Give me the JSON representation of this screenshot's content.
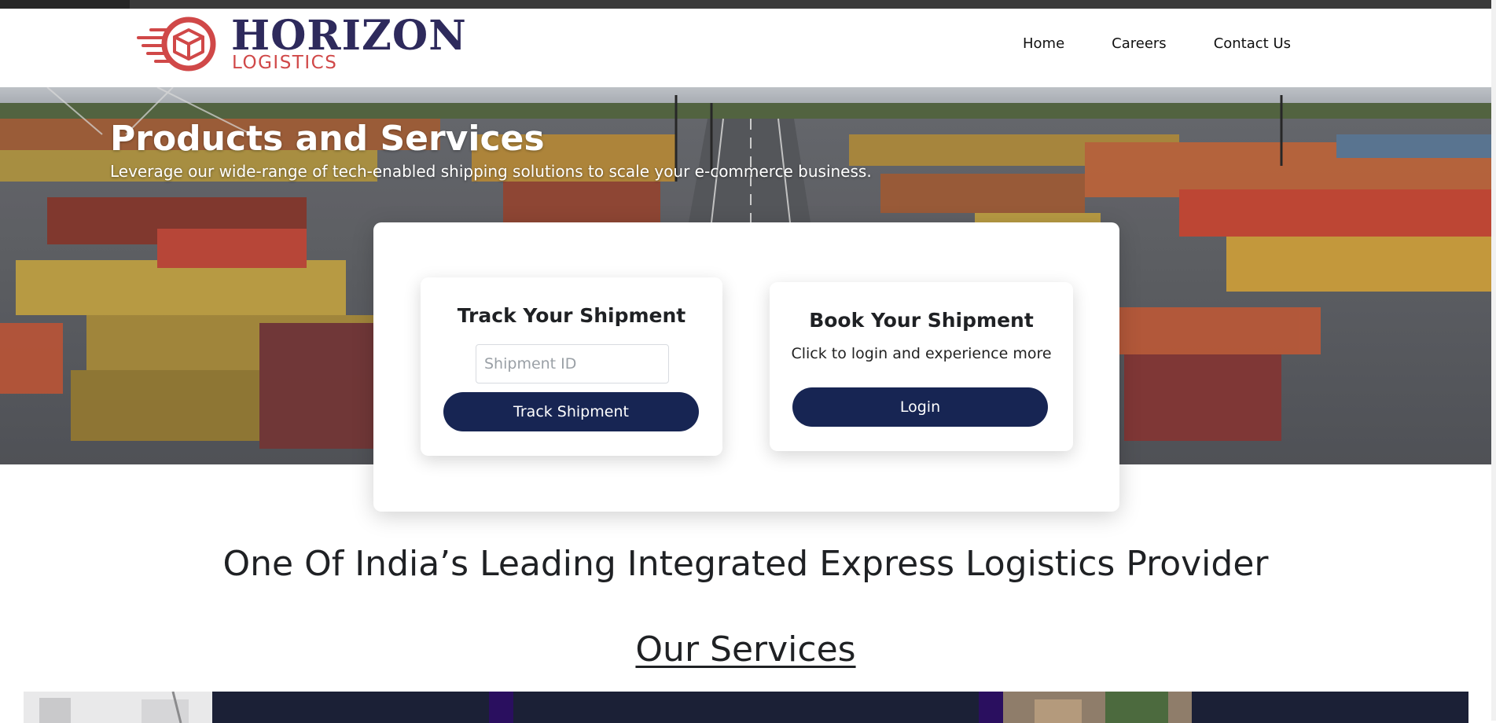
{
  "header": {
    "logo": {
      "name": "HORIZON",
      "sub": "LOGISTICS"
    },
    "nav": [
      {
        "label": "Home"
      },
      {
        "label": "Careers"
      },
      {
        "label": "Contact Us"
      }
    ]
  },
  "hero": {
    "title": "Products and Services",
    "subtitle": "Leverage our wide-range of tech-enabled shipping solutions to scale your e-commerce business."
  },
  "track": {
    "title": "Track Your Shipment",
    "input_placeholder": "Shipment ID",
    "button": "Track Shipment"
  },
  "book": {
    "title": "Book Your Shipment",
    "text": "Click to login and experience more",
    "button": "Login"
  },
  "tagline": "One Of India’s Leading Integrated Express Logistics Provider",
  "services": {
    "title": "Our Services"
  },
  "colors": {
    "navy": "#172553",
    "brand_dark": "#2e2a5c",
    "brand_red": "#d04848",
    "service_bg": "#1b2036"
  }
}
